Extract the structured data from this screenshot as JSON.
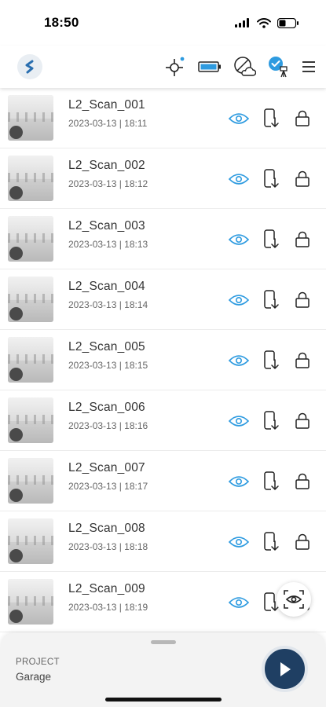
{
  "status_bar": {
    "time": "18:50"
  },
  "header": {
    "icons": [
      "app-logo",
      "crosshair-target-icon",
      "battery-indicator-icon",
      "cloud-offline-icon",
      "device-connected-icon",
      "menu-icon"
    ]
  },
  "scans": [
    {
      "name": "L2_Scan_001",
      "date": "2023-03-13 | 18:11"
    },
    {
      "name": "L2_Scan_002",
      "date": "2023-03-13 | 18:12"
    },
    {
      "name": "L2_Scan_003",
      "date": "2023-03-13 | 18:13"
    },
    {
      "name": "L2_Scan_004",
      "date": "2023-03-13 | 18:14"
    },
    {
      "name": "L2_Scan_005",
      "date": "2023-03-13 | 18:15"
    },
    {
      "name": "L2_Scan_006",
      "date": "2023-03-13 | 18:16"
    },
    {
      "name": "L2_Scan_007",
      "date": "2023-03-13 | 18:17"
    },
    {
      "name": "L2_Scan_008",
      "date": "2023-03-13 | 18:18"
    },
    {
      "name": "L2_Scan_009",
      "date": "2023-03-13 | 18:19"
    }
  ],
  "bottom_sheet": {
    "project_label": "PROJECT",
    "project_name": "Garage"
  },
  "colors": {
    "accent_blue": "#2e9be0",
    "play_button": "#1f3f63",
    "icon_dark": "#222222"
  }
}
